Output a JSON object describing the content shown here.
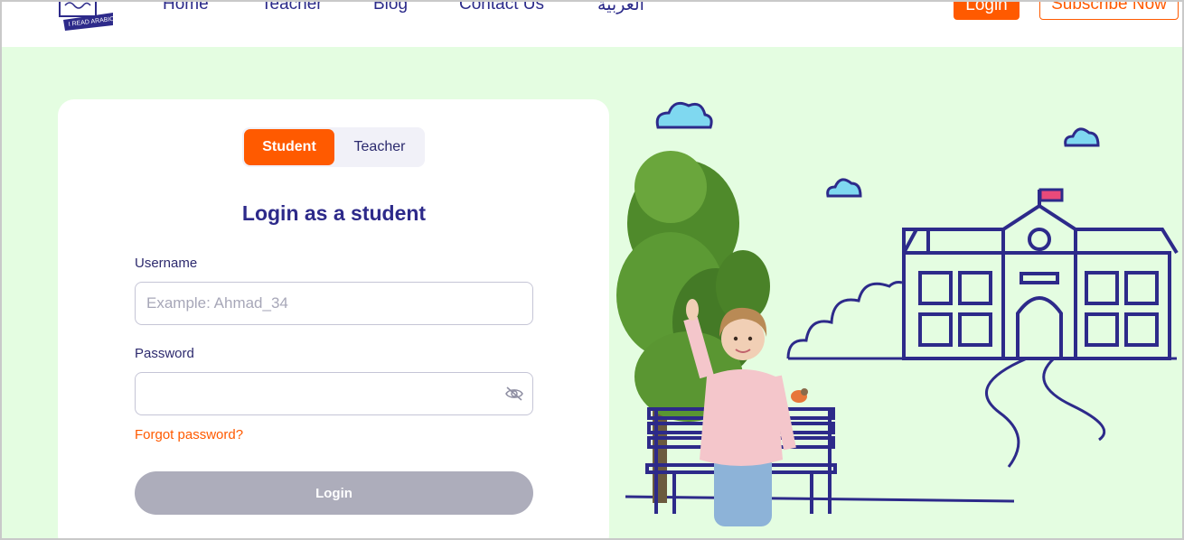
{
  "header": {
    "logo_text": "I READ ARABIC",
    "nav": [
      "Home",
      "Teacher",
      "Blog",
      "Contact Us",
      "العربية"
    ],
    "login_label": "Login",
    "subscribe_label": "Subscribe Now"
  },
  "login_card": {
    "tabs": [
      {
        "label": "Student",
        "active": true
      },
      {
        "label": "Teacher",
        "active": false
      }
    ],
    "title": "Login as a student",
    "username_label": "Username",
    "username_placeholder": "Example: Ahmad_34",
    "username_value": "",
    "password_label": "Password",
    "password_value": "",
    "forgot_label": "Forgot password?",
    "submit_label": "Login"
  },
  "colors": {
    "brand_orange": "#ff5a00",
    "brand_navy": "#2d2a8a",
    "hero_bg": "#e4fde1",
    "disabled_button": "#adadbb"
  },
  "icons": {
    "password_toggle": "eye-slash-icon"
  }
}
